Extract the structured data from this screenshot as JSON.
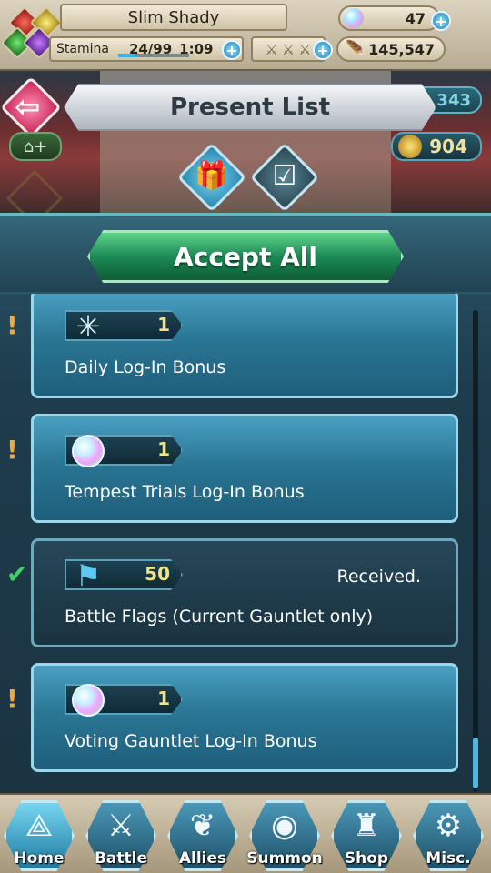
{
  "status_bar": {
    "player_name": "Slim Shady",
    "stamina_label": "Stamina",
    "stamina_value": "24/99",
    "stamina_timer": "1:09",
    "stamina_fraction": 0.2424,
    "orbs": "47",
    "feathers": "145,547"
  },
  "header": {
    "title": "Present List",
    "right_pill_partial": "343",
    "gold_count": "904"
  },
  "accept_all_label": "Accept All",
  "presents": [
    {
      "icon": "sparkle-icon",
      "qty": "1",
      "label": "Daily Log-In Bonus",
      "status": "",
      "mark": "!"
    },
    {
      "icon": "orb-icon",
      "qty": "1",
      "label": "Tempest Trials Log-In Bonus",
      "status": "",
      "mark": "!"
    },
    {
      "icon": "battle-flag-icon",
      "qty": "50",
      "label": "Battle Flags (Current Gauntlet only)",
      "status": "Received.",
      "mark": "✔"
    },
    {
      "icon": "orb-icon",
      "qty": "1",
      "label": "Voting Gauntlet Log-In Bonus",
      "status": "",
      "mark": "!"
    }
  ],
  "nav": {
    "home": "Home",
    "battle": "Battle",
    "allies": "Allies",
    "summon": "Summon",
    "shop": "Shop",
    "misc": "Misc."
  },
  "colors": {
    "accent": "#4fb6dc",
    "accept_green": "#1c8a55",
    "received_check": "#3fd167",
    "alert_orange": "#f0a93b"
  }
}
